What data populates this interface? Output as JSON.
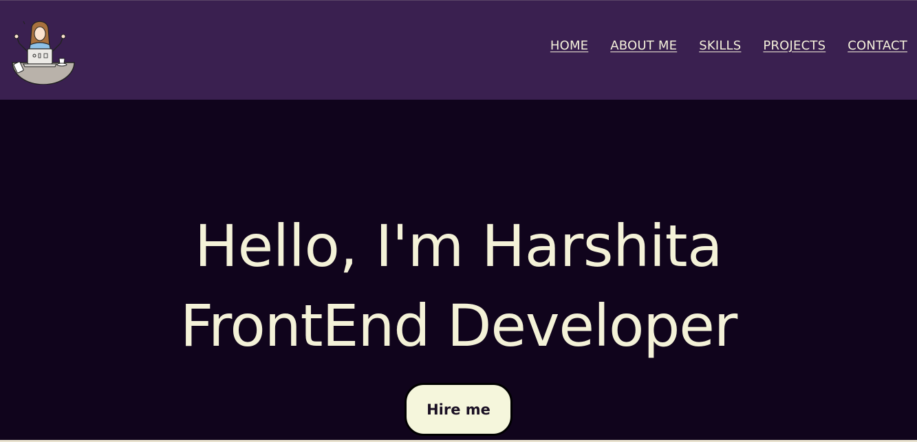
{
  "nav": {
    "items": [
      {
        "label": "HOME"
      },
      {
        "label": "ABOUT ME"
      },
      {
        "label": "SKILLS"
      },
      {
        "label": "PROJECTS"
      },
      {
        "label": "CONTACT"
      }
    ]
  },
  "hero": {
    "line1": "Hello, I'm Harshita",
    "line2": "FrontEnd Developer",
    "cta_label": "Hire me"
  },
  "colors": {
    "header_bg": "#3a2050",
    "hero_bg": "#10041c",
    "text_cream": "#f4f2d8",
    "button_bg": "#f5f6dc"
  },
  "icons": {
    "logo": "developer-girl-avatar-icon"
  }
}
